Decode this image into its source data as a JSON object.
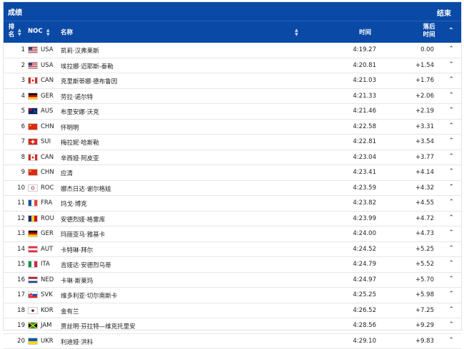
{
  "header": {
    "title": "成绩",
    "finished": "结束",
    "col_rank": "排名",
    "col_noc": "NOC",
    "col_name": "名称",
    "col_time": "时间",
    "col_behind": "落后时间"
  },
  "rows": [
    {
      "rank": "1",
      "noc": "USA",
      "name": "凯莉·汉弗莱斯",
      "time": "4:19.27",
      "behind": "0.00",
      "flag": "USA"
    },
    {
      "rank": "2",
      "noc": "USA",
      "name": "埃拉娜·迈耶斯-泰勒",
      "time": "4:20.81",
      "behind": "+1.54",
      "flag": "USA"
    },
    {
      "rank": "3",
      "noc": "CAN",
      "name": "克里斯蒂娜·德布鲁因",
      "time": "4:21.03",
      "behind": "+1.76",
      "flag": "CAN"
    },
    {
      "rank": "4",
      "noc": "GER",
      "name": "劳拉·诺尔特",
      "time": "4:21.33",
      "behind": "+2.06",
      "flag": "GER"
    },
    {
      "rank": "5",
      "noc": "AUS",
      "name": "布里安娜·沃克",
      "time": "4:21.46",
      "behind": "+2.19",
      "flag": "AUS"
    },
    {
      "rank": "6",
      "noc": "CHN",
      "name": "怀明明",
      "time": "4:22.58",
      "behind": "+3.31",
      "flag": "CHN"
    },
    {
      "rank": "7",
      "noc": "SUI",
      "name": "梅拉妮·哈斯勒",
      "time": "4:22.81",
      "behind": "+3.54",
      "flag": "SUI"
    },
    {
      "rank": "8",
      "noc": "CAN",
      "name": "辛西娅·阿皮亚",
      "time": "4:23.04",
      "behind": "+3.77",
      "flag": "CAN"
    },
    {
      "rank": "9",
      "noc": "CHN",
      "name": "应清",
      "time": "4:23.41",
      "behind": "+4.14",
      "flag": "CHN"
    },
    {
      "rank": "10",
      "noc": "ROC",
      "name": "娜杰日达·谢尔格娃",
      "time": "4:23.59",
      "behind": "+4.32",
      "flag": "ROC"
    },
    {
      "rank": "11",
      "noc": "FRA",
      "name": "玛戈·博克",
      "time": "4:23.82",
      "behind": "+4.55",
      "flag": "FRA"
    },
    {
      "rank": "12",
      "noc": "ROU",
      "name": "安德烈娅·格雷库",
      "time": "4:23.99",
      "behind": "+4.72",
      "flag": "ROU"
    },
    {
      "rank": "13",
      "noc": "GER",
      "name": "玛丽亚马·雅基卡",
      "time": "4:24.00",
      "behind": "+4.73",
      "flag": "GER"
    },
    {
      "rank": "14",
      "noc": "AUT",
      "name": "卡特琳·拜尔",
      "time": "4:24.52",
      "behind": "+5.25",
      "flag": "AUT"
    },
    {
      "rank": "15",
      "noc": "ITA",
      "name": "吉娅达·安德烈乌蒂",
      "time": "4:24.79",
      "behind": "+5.52",
      "flag": "ITA"
    },
    {
      "rank": "16",
      "noc": "NED",
      "name": "卡琳·斯莱玛",
      "time": "4:24.97",
      "behind": "+5.70",
      "flag": "NED"
    },
    {
      "rank": "17",
      "noc": "SVK",
      "name": "维多利亚·切尔南斯卡",
      "time": "4:25.25",
      "behind": "+5.98",
      "flag": "SVK"
    },
    {
      "rank": "18",
      "noc": "KOR",
      "name": "金有兰",
      "time": "4:26.52",
      "behind": "+7.25",
      "flag": "KOR"
    },
    {
      "rank": "19",
      "noc": "JAM",
      "name": "贾丝明·芬拉特—维克托里安",
      "time": "4:28.56",
      "behind": "+9.29",
      "flag": "JAM"
    },
    {
      "rank": "20",
      "noc": "UKR",
      "name": "利迪娅·洪科",
      "time": "4:29.10",
      "behind": "+9.83",
      "flag": "UKR"
    }
  ]
}
